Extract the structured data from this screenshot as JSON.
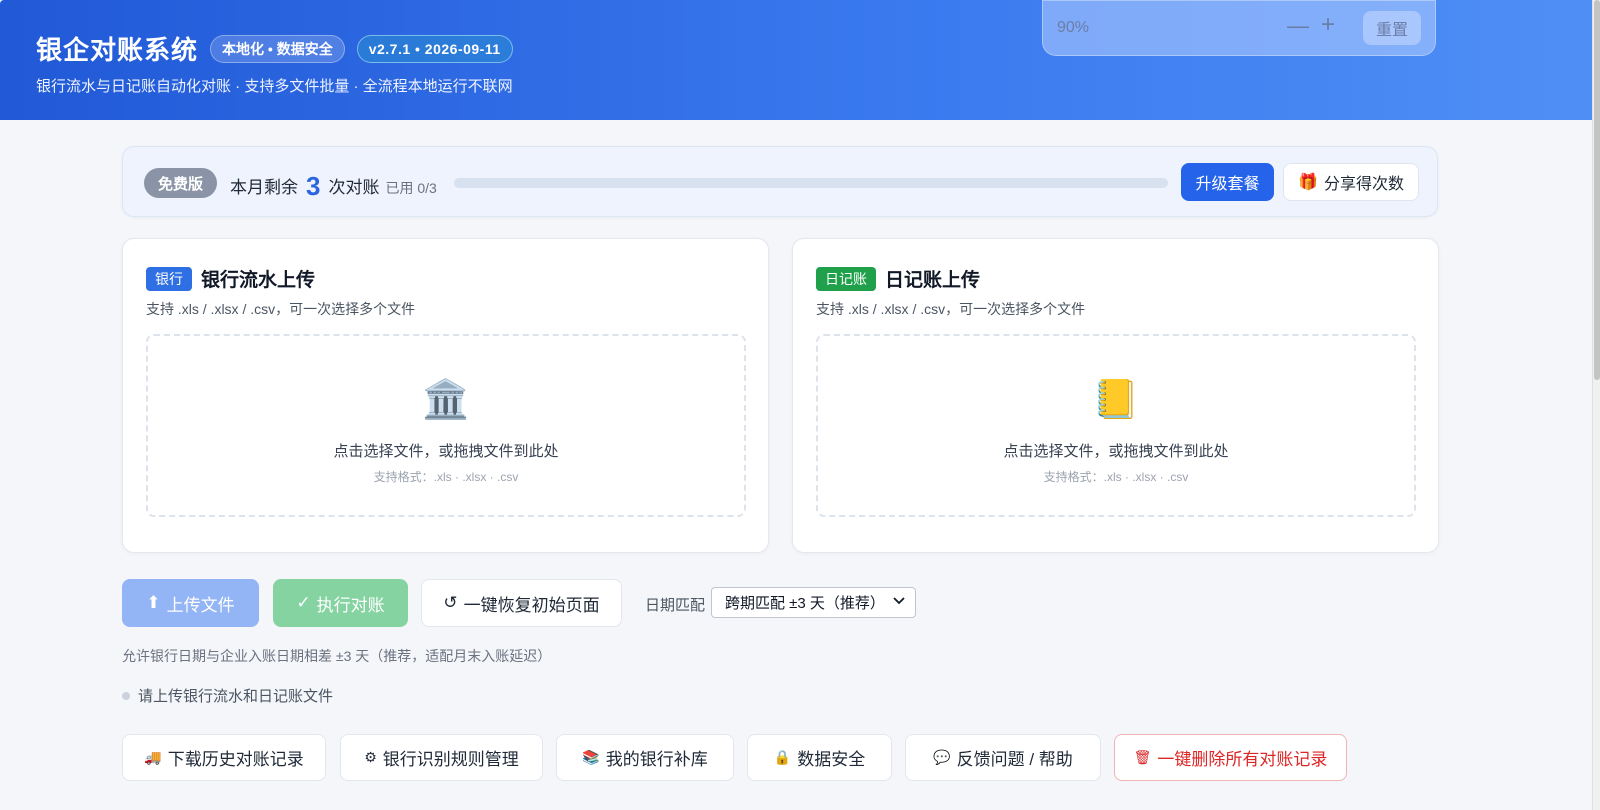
{
  "header": {
    "title": "银企对账系统",
    "badge_local": "本地化 • 数据安全",
    "badge_version": "v2.7.1 • 2026-09-11",
    "subtitle": "银行流水与日记账自动化对账 · 支持多文件批量 · 全流程本地运行不联网"
  },
  "zoom": {
    "value": "90%",
    "minus": "—",
    "plus": "+",
    "reset": "重置"
  },
  "quota": {
    "plan": "免费版",
    "prefix": "本月剩余",
    "remaining": "3",
    "suffix": "次对账",
    "used": "已用 0/3",
    "used_fraction": 0,
    "upgrade": "升级套餐",
    "share": "分享得次数"
  },
  "bank_card": {
    "tag": "银行",
    "title": "银行流水上传",
    "subtitle": "支持 .xls / .xlsx / .csv，可一次选择多个文件",
    "drop_text": "点击选择文件，或拖拽文件到此处",
    "drop_hint": "支持格式：.xls · .xlsx · .csv"
  },
  "journal_card": {
    "tag": "日记账",
    "title": "日记账上传",
    "subtitle": "支持 .xls / .xlsx / .csv，可一次选择多个文件",
    "drop_text": "点击选择文件，或拖拽文件到此处",
    "drop_hint": "支持格式：.xls · .xlsx · .csv"
  },
  "actions": {
    "upload": "上传文件",
    "run": "执行对账",
    "reset": "一键恢复初始页面",
    "date_label": "日期匹配",
    "date_selected": "跨期匹配 ±3 天（推荐）",
    "date_hint": "允许银行日期与企业入账日期相差 ±3 天（推荐，适配月末入账延迟）",
    "status": "请上传银行流水和日记账文件"
  },
  "toolbar": {
    "history": "下载历史对账记录",
    "rules": "银行识别规则管理",
    "bank_lib": "我的银行补库",
    "security": "数据安全",
    "feedback": "反馈问题 / 帮助",
    "delete_all": "一键删除所有对账记录"
  },
  "icons": {
    "bank": "bank-building-icon",
    "journal": "notebook-icon",
    "gift": "gift-icon",
    "upload": "upload-arrow-icon",
    "check": "check-icon",
    "reset": "refresh-icon",
    "truck": "truck-icon",
    "gear": "gear-icon",
    "books": "books-icon",
    "lock": "lock-icon",
    "chat": "speech-bubble-icon",
    "trash": "trash-icon"
  },
  "colors": {
    "primary": "#2563eb",
    "header_start": "#2159d6",
    "header_end": "#4f8ff5",
    "success": "#20a04a",
    "danger": "#dc2626"
  }
}
